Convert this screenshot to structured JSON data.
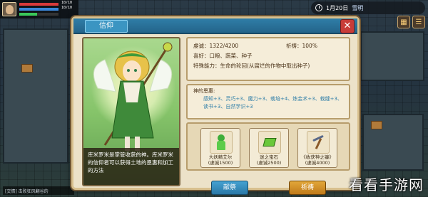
{
  "hud": {
    "hp_text": "10/10",
    "mp_text": "10/10",
    "xp_level": 0.45,
    "date": "1月20日",
    "weather": "雪明"
  },
  "ticker": "[交情] 击败狂风翻谷的",
  "dialog": {
    "title": "信仰",
    "close_label": "✕"
  },
  "portrait": {
    "caption": "库米罗米是掌管收获的神。库米罗米的信仰者可以获得土地的恩惠和加工的方法"
  },
  "info": {
    "piety": "虔诚：1322/4200",
    "prayer": "祈祷：100%",
    "preference": "喜好：口粮、蔬菜、种子",
    "special": "特殊能力：生命的轮回(从腐烂的作物中取出种子)"
  },
  "blessing": {
    "title": "神的恩惠:",
    "line1": "感知+3、灵巧+3、魔力+3、栽培+4、炼金术+3、栽缝+3、读书+3、自然学识+3"
  },
  "offerings": [
    {
      "name": "大妖精艾尔",
      "cost": "(虔诚1500)",
      "icon": "spirit-icon"
    },
    {
      "name": "迷之宝石",
      "cost": "(虔诚2500)",
      "icon": "gem-icon"
    },
    {
      "name": "《收获神之镰》",
      "cost": "(虔诚4000)",
      "icon": "scythe-icon"
    }
  ],
  "buttons": {
    "offer_label": "献祭",
    "pray_label": "祈祷"
  },
  "watermark": "看看手游网",
  "colors": {
    "title_bar": "#2f7ea8",
    "panel_bg": "#ece2c9",
    "offer_button": "#2a78a6",
    "pray_button": "#c07a1a",
    "blessing_text": "#2f7ea8"
  }
}
